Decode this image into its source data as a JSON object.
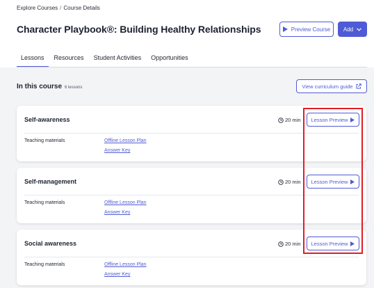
{
  "breadcrumb": {
    "items": [
      "Explore Courses",
      "Course Details"
    ],
    "separator": "/"
  },
  "page": {
    "title": "Character Playbook®: Building Healthy Relationships"
  },
  "header_actions": {
    "preview_course": "Preview Course",
    "add": "Add"
  },
  "tabs": [
    {
      "label": "Lessons",
      "active": true
    },
    {
      "label": "Resources",
      "active": false
    },
    {
      "label": "Student Activities",
      "active": false
    },
    {
      "label": "Opportunities",
      "active": false
    }
  ],
  "course": {
    "heading": "In this course",
    "count": "6 lessons",
    "guide_button": "View curriculum guide"
  },
  "lessons": [
    {
      "title": "Self-awareness",
      "duration": "20 min",
      "preview_label": "Lesson Preview",
      "materials_label": "Teaching materials",
      "links": [
        "Offline Lesson Plan",
        "Answer Key"
      ]
    },
    {
      "title": "Self-management",
      "duration": "20 min",
      "preview_label": "Lesson Preview",
      "materials_label": "Teaching materials",
      "links": [
        "Offline Lesson Plan",
        "Answer Key"
      ]
    },
    {
      "title": "Social awareness",
      "duration": "20 min",
      "preview_label": "Lesson Preview",
      "materials_label": "Teaching materials",
      "links": [
        "Offline Lesson Plan",
        "Answer Key"
      ]
    }
  ],
  "colors": {
    "accent": "#4f5bd5",
    "highlight": "#e11d24",
    "background": "#f3f4f6"
  },
  "icons": {
    "play": "play-icon",
    "clock": "clock-icon",
    "chevron": "chevron-down-icon",
    "external": "external-link-icon"
  }
}
